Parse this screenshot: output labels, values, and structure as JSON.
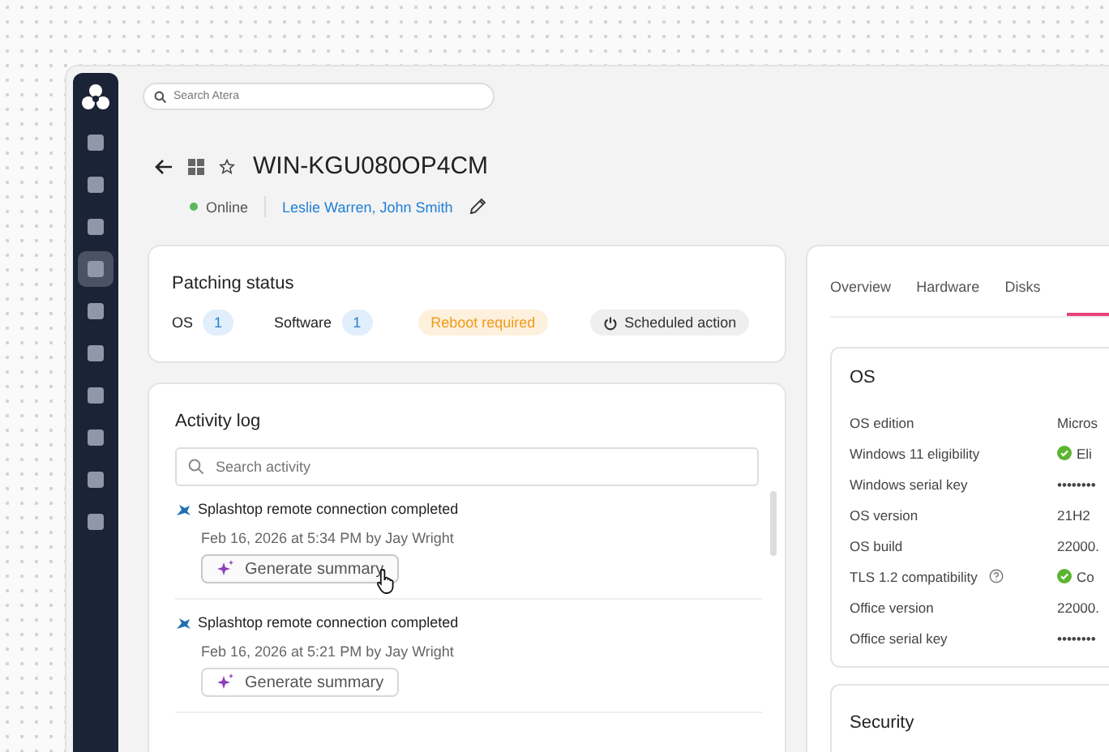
{
  "sidebar": {
    "items": [
      {
        "selected": false
      },
      {
        "selected": false
      },
      {
        "selected": false
      },
      {
        "selected": true
      },
      {
        "selected": false
      },
      {
        "selected": false
      },
      {
        "selected": false
      },
      {
        "selected": false
      },
      {
        "selected": false
      },
      {
        "selected": false
      }
    ]
  },
  "search": {
    "placeholder": "Search Atera"
  },
  "device": {
    "name": "WIN-KGU080OP4CM",
    "favorite": false,
    "status": "Online",
    "online": true,
    "assignees": "Leslie Warren, John Smith"
  },
  "patching": {
    "title": "Patching status",
    "counts": [
      {
        "label": "OS",
        "count": "1"
      },
      {
        "label": "Software",
        "count": "1"
      }
    ],
    "badge": "Reboot required",
    "action": "Scheduled action"
  },
  "activity": {
    "title": "Activity log",
    "placeholder": "Search activity",
    "entries": [
      {
        "title": "Splashtop remote connection completed",
        "meta": "Feb 16, 2026 at 5:34 PM by Jay Wright",
        "button": "Generate summary",
        "hovered": true
      },
      {
        "title": "Splashtop remote connection completed",
        "meta": "Feb 16, 2026 at 5:21 PM by Jay Wright",
        "button": "Generate summary",
        "hovered": false
      }
    ]
  },
  "tabs": [
    {
      "label": "Overview",
      "selected": false
    },
    {
      "label": "Hardware",
      "selected": false
    },
    {
      "label": "Disks",
      "selected": false
    },
    {
      "selected": true
    }
  ],
  "os_card": {
    "title": "OS",
    "rows": [
      {
        "label": "OS edition",
        "value": "Micros",
        "kind": "text"
      },
      {
        "label": "Windows 11 eligibility",
        "value": "Eli",
        "kind": "check"
      },
      {
        "label": "Windows serial key",
        "value": "••••••••",
        "kind": "text"
      },
      {
        "label": "OS version",
        "value": "21H2",
        "kind": "text"
      },
      {
        "label": "OS build",
        "value": "22000.",
        "kind": "text"
      },
      {
        "label": "TLS 1.2 compatibility",
        "value": "Co",
        "kind": "check",
        "help": true
      },
      {
        "label": "Office version",
        "value": "22000.",
        "kind": "text"
      },
      {
        "label": "Office serial key",
        "value": "••••••••",
        "kind": "text"
      }
    ]
  },
  "security_card": {
    "title": "Security"
  }
}
